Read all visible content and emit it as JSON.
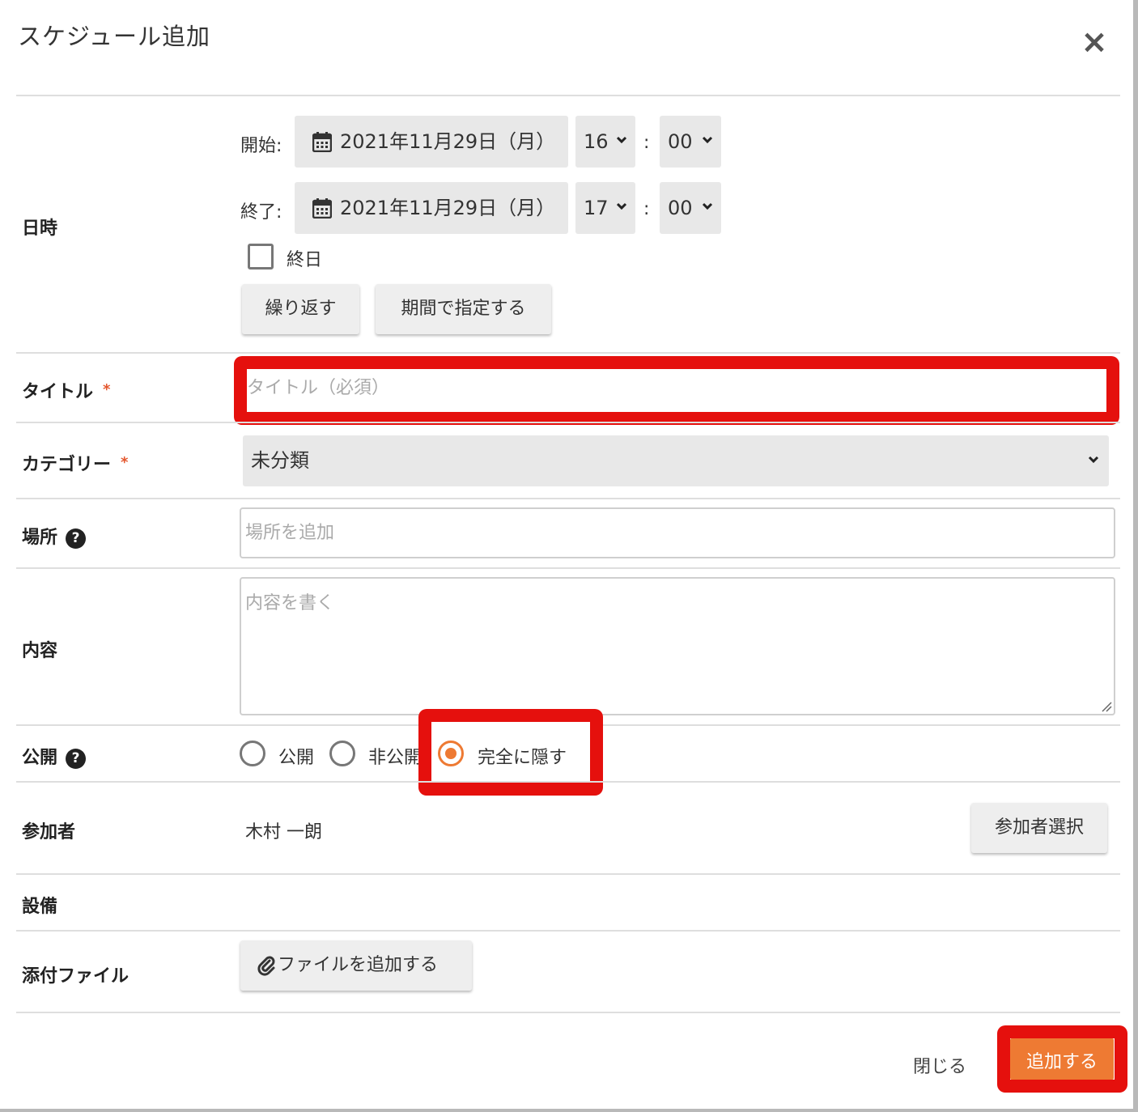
{
  "dialog": {
    "title": "スケジュール追加"
  },
  "datetime": {
    "label": "日時",
    "start_label": "開始:",
    "end_label": "終了:",
    "start_date": "2021年11月29日（月）",
    "start_hour": "16",
    "start_minute": "00",
    "end_date": "2021年11月29日（月）",
    "end_hour": "17",
    "end_minute": "00",
    "time_separator": ":",
    "all_day_label": "終日",
    "all_day_checked": false,
    "repeat_button": "繰り返す",
    "period_button": "期間で指定する"
  },
  "title_field": {
    "label": "タイトル",
    "required_mark": "*",
    "placeholder": "タイトル（必須）"
  },
  "category": {
    "label": "カテゴリー",
    "required_mark": "*",
    "selected": "未分類"
  },
  "location": {
    "label": "場所",
    "placeholder": "場所を追加"
  },
  "content": {
    "label": "内容",
    "placeholder": "内容を書く"
  },
  "visibility": {
    "label": "公開",
    "options": [
      {
        "label": "公開",
        "checked": false
      },
      {
        "label": "非公開",
        "checked": false
      },
      {
        "label": "完全に隠す",
        "checked": true
      }
    ]
  },
  "participants": {
    "label": "参加者",
    "value": "木村 一朗",
    "select_button": "参加者選択"
  },
  "equipment": {
    "label": "設備"
  },
  "attachment": {
    "label": "添付ファイル",
    "add_button": "ファイルを追加する"
  },
  "footer": {
    "close_label": "閉じる",
    "submit_label": "追加する"
  },
  "colors": {
    "accent": "#ee7a33",
    "highlight": "#e5100d",
    "required": "#e4572e"
  }
}
